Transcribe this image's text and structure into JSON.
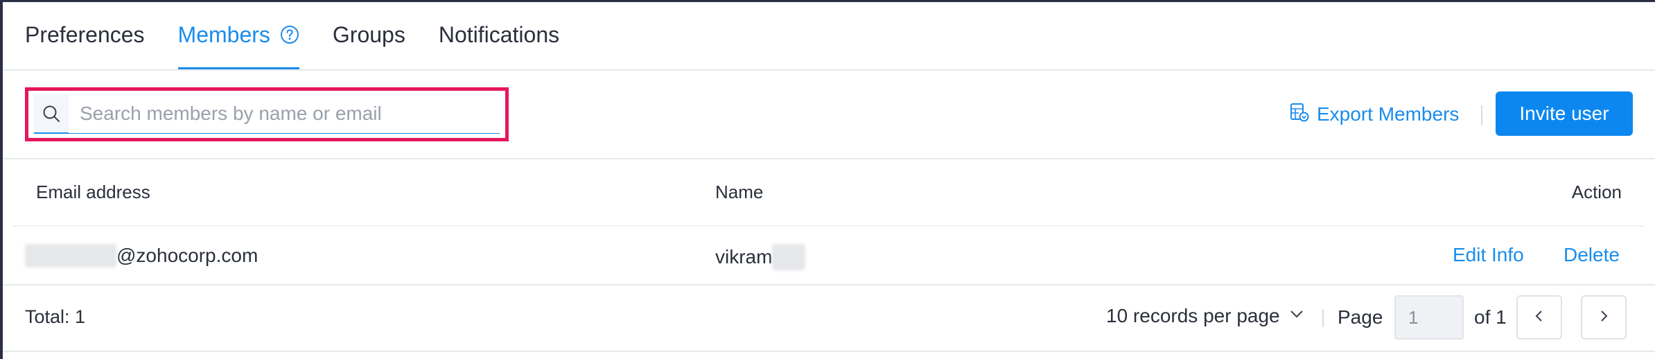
{
  "tabs": [
    {
      "label": "Preferences",
      "active": false
    },
    {
      "label": "Members",
      "active": true
    },
    {
      "label": "Groups",
      "active": false
    },
    {
      "label": "Notifications",
      "active": false
    }
  ],
  "search": {
    "placeholder": "Search members by name or email",
    "value": ""
  },
  "toolbar": {
    "export_label": "Export Members",
    "invite_label": "Invite user"
  },
  "table": {
    "columns": [
      "Email address",
      "Name",
      "Action"
    ],
    "rows": [
      {
        "email_visible": "@zohocorp.com",
        "name_visible": "vikram",
        "actions": [
          "Edit Info",
          "Delete"
        ]
      }
    ]
  },
  "footer": {
    "total": "Total: 1",
    "per_page": "10 records per page",
    "page_label": "Page",
    "page_value": "1",
    "of_label": "of 1"
  },
  "colors": {
    "accent": "#1a8ceb",
    "button": "#0d87f0",
    "highlight_border": "#e5175a",
    "text": "#2a2f3a"
  },
  "icons": {
    "help": "question-circle-icon",
    "search": "search-icon",
    "export": "spreadsheet-download-icon",
    "dropdown": "chevron-down-icon",
    "prev": "chevron-left-icon",
    "next": "chevron-right-icon"
  }
}
